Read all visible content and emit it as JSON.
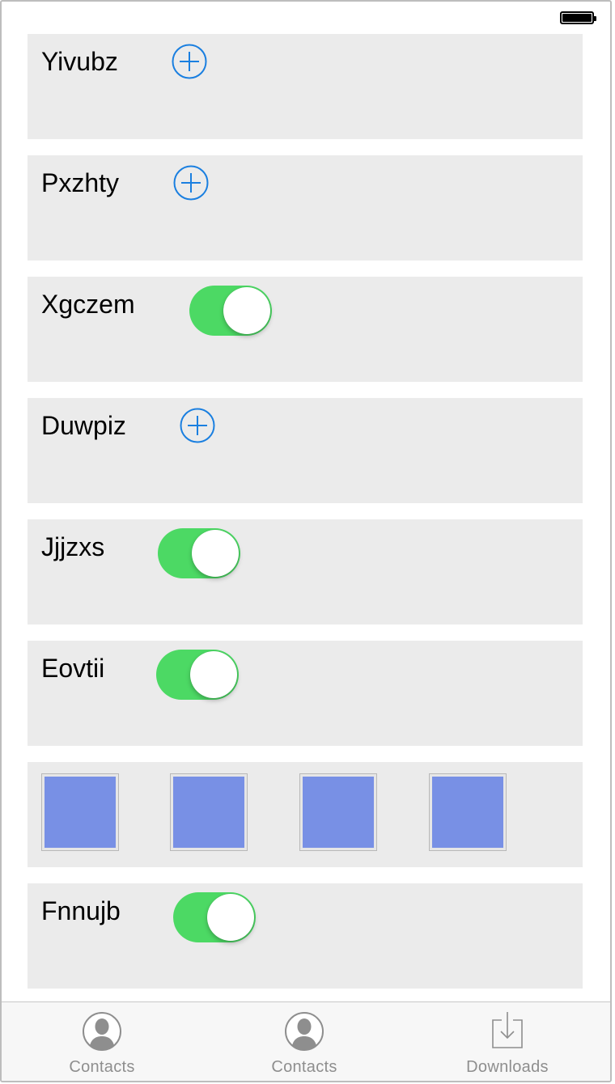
{
  "status_bar": {
    "battery_icon": "battery-full-icon"
  },
  "rows": [
    {
      "type": "add",
      "label": "Yivubz",
      "icon": "plus-circle-icon"
    },
    {
      "type": "add",
      "label": "Pxzhty",
      "icon": "plus-circle-icon"
    },
    {
      "type": "switch",
      "label": "Xgczem",
      "on": true
    },
    {
      "type": "add",
      "label": "Duwpiz",
      "icon": "plus-circle-icon"
    },
    {
      "type": "switch",
      "label": "Jjjzxs",
      "on": true
    },
    {
      "type": "switch",
      "label": "Eovtii",
      "on": true
    },
    {
      "type": "tiles",
      "count": 4
    },
    {
      "type": "switch",
      "label": "Fnnujb",
      "on": true
    }
  ],
  "tabbar": {
    "tabs": [
      {
        "label": "Contacts",
        "icon": "contact-person-icon"
      },
      {
        "label": "Contacts",
        "icon": "contact-person-icon"
      },
      {
        "label": "Downloads",
        "icon": "download-tray-icon"
      }
    ]
  },
  "colors": {
    "switch_on": "#4cd964",
    "accent_blue": "#1a7fe0",
    "tile_blue": "#7890e5",
    "row_bg": "#ebebeb",
    "tab_text": "#8e8e8e"
  }
}
